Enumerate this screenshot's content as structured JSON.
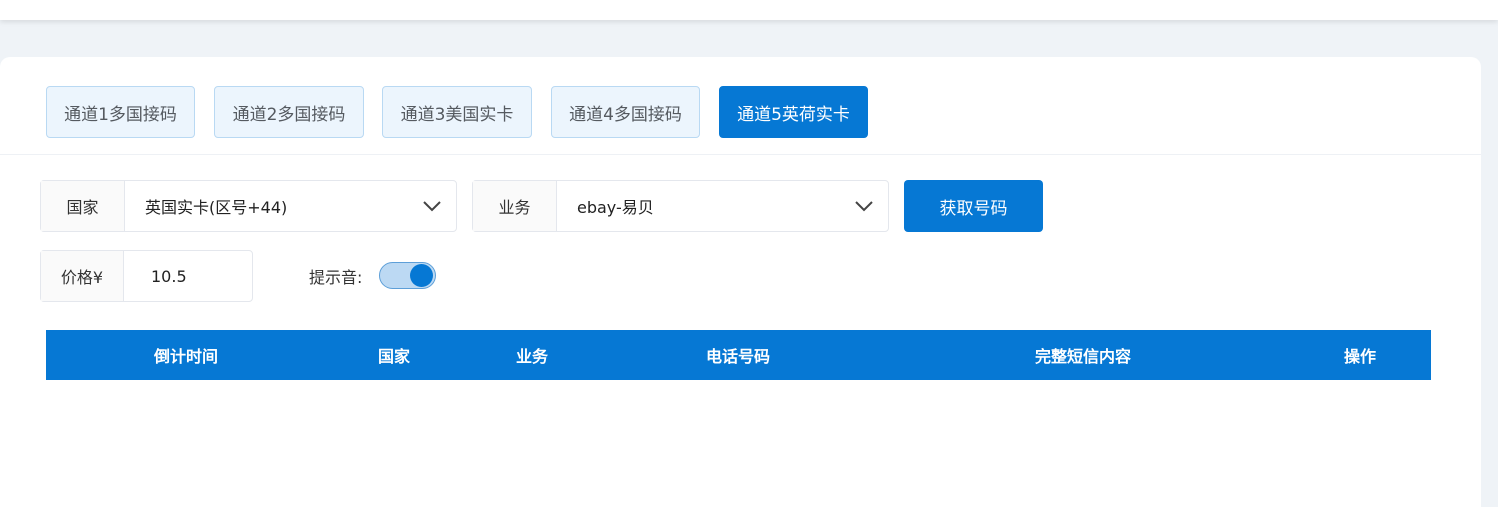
{
  "tabs": [
    {
      "label": "通道1多国接码",
      "active": false
    },
    {
      "label": "通道2多国接码",
      "active": false
    },
    {
      "label": "通道3美国实卡",
      "active": false
    },
    {
      "label": "通道4多国接码",
      "active": false
    },
    {
      "label": "通道5英荷实卡",
      "active": true
    }
  ],
  "form": {
    "country_label": "国家",
    "country_value": "英国实卡(区号+44)",
    "service_label": "业务",
    "service_value": "ebay-易贝",
    "get_number_button": "获取号码",
    "price_label": "价格¥",
    "price_value": "10.5",
    "sound_label": "提示音:",
    "sound_enabled": true
  },
  "table": {
    "columns": [
      "倒计时间",
      "国家",
      "业务",
      "电话号码",
      "完整短信内容",
      "操作"
    ],
    "rows": []
  },
  "colors": {
    "primary": "#0678d4",
    "tab_bg": "#ecf5fd",
    "page_bg": "#eff3f7"
  }
}
